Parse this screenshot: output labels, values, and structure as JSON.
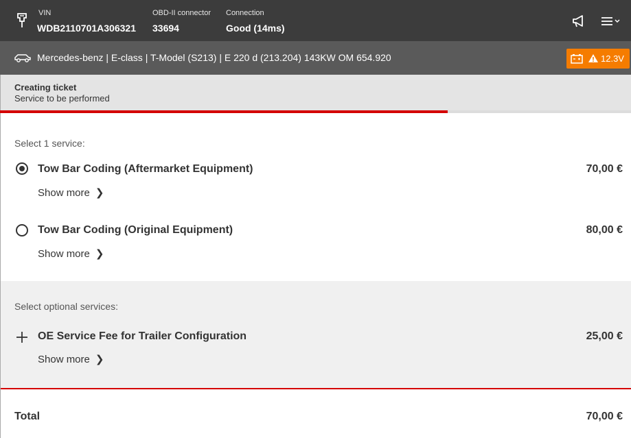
{
  "header": {
    "vin_label": "VIN",
    "vin_value": "WDB2110701A306321",
    "obd_label": "OBD-II connector",
    "obd_value": "33694",
    "connection_label": "Connection",
    "connection_value": "Good (14ms)"
  },
  "vehicle": {
    "description": "Mercedes-benz | E-class | T-Model (S213) | E 220 d (213.204) 143KW OM 654.920",
    "battery_voltage": "12.3V",
    "battery_badge_color": "#f57c00"
  },
  "ticket": {
    "title": "Creating ticket",
    "subtitle": "Service to be performed",
    "progress_fraction": 0.71
  },
  "services": {
    "section_label": "Select 1 service:",
    "items": [
      {
        "name": "Tow Bar Coding (Aftermarket Equipment)",
        "price": "70,00 €",
        "show_more": "Show more",
        "selected": true
      },
      {
        "name": "Tow Bar Coding (Original Equipment)",
        "price": "80,00 €",
        "show_more": "Show more",
        "selected": false
      }
    ]
  },
  "optional": {
    "section_label": "Select optional services:",
    "items": [
      {
        "name": "OE Service Fee for Trailer Configuration",
        "price": "25,00 €",
        "show_more": "Show more"
      }
    ]
  },
  "summary": {
    "total_label": "Total",
    "total_price": "70,00 €"
  },
  "colors": {
    "accent_red": "#d40000",
    "topbar_bg": "#3c3c3c",
    "vehiclebar_bg": "#5a5a5a"
  },
  "icons": {
    "connector": "plug-icon",
    "announcements": "megaphone-icon",
    "menu": "hamburger-menu-icon",
    "car": "car-icon",
    "battery": "battery-icon",
    "warning": "warning-icon",
    "chevron": "chevron-right-icon",
    "add": "plus-icon"
  }
}
